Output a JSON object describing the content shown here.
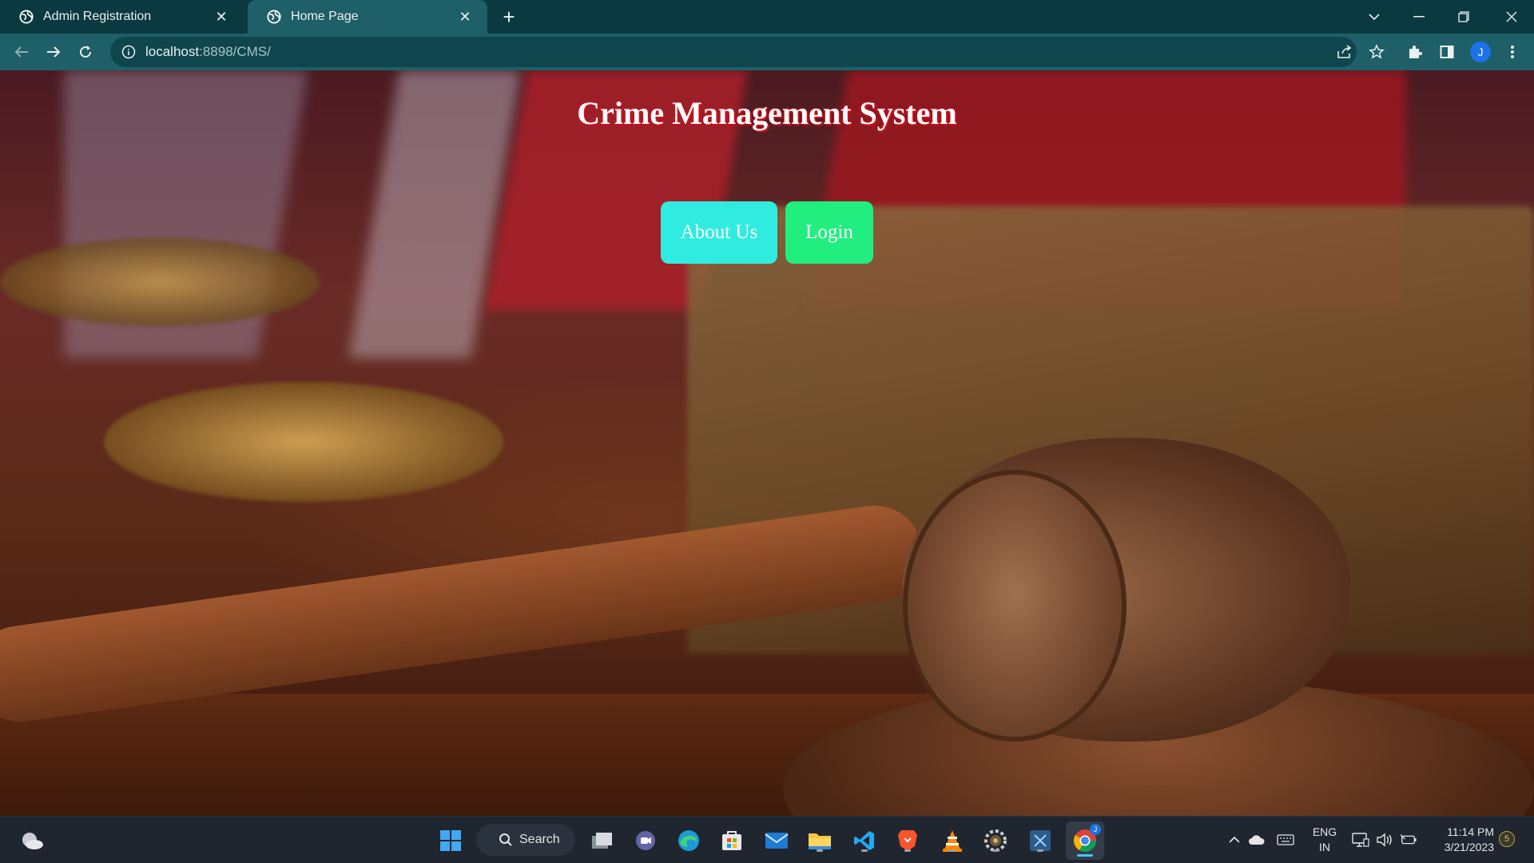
{
  "browser": {
    "tabs": [
      {
        "title": "Admin Registration",
        "active": false
      },
      {
        "title": "Home Page",
        "active": true
      }
    ],
    "url_host": "localhost",
    "url_rest": ":8898/CMS/",
    "profile_initial": "J",
    "theme_color": "#1f5f67"
  },
  "page": {
    "title": "Crime Management System",
    "buttons": {
      "about_label": "About Us",
      "login_label": "Login"
    },
    "colors": {
      "title_shadow": "#c8101a",
      "about_bg": "#30ece0",
      "login_bg": "#22ee80"
    }
  },
  "taskbar": {
    "search_label": "Search",
    "lang_line1": "ENG",
    "lang_line2": "IN",
    "time": "11:14 PM",
    "date": "3/21/2023",
    "notification_count": "5",
    "profile_badge": "J",
    "apps": [
      "start-icon",
      "search-icon",
      "task-view-icon",
      "teams-icon",
      "edge-icon",
      "store-icon",
      "mail-icon",
      "file-explorer-icon",
      "vscode-icon",
      "brave-icon",
      "vlc-icon",
      "settings-icon",
      "snipping-icon",
      "chrome-icon"
    ]
  }
}
